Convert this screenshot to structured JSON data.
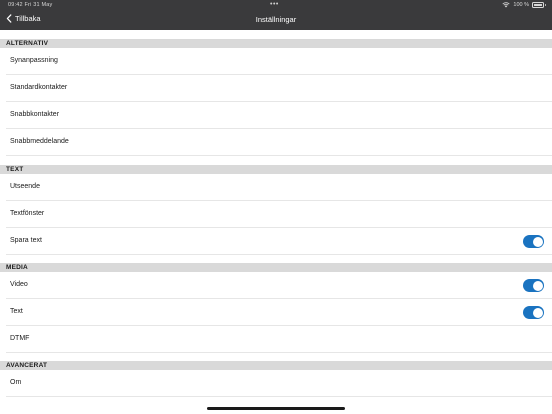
{
  "status": {
    "time": "09:42",
    "date": "Fri 31 May",
    "dots": "•••",
    "battery": "100 %"
  },
  "nav": {
    "back_label": "Tillbaka",
    "title": "Inställningar"
  },
  "sections": {
    "alternativ": {
      "header": "ALTERNATIV",
      "items": [
        "Synanpassning",
        "Standardkontakter",
        "Snabbkontakter",
        "Snabbmeddelande"
      ]
    },
    "text": {
      "header": "TEXT",
      "items": [
        "Utseende",
        "Textfönster",
        "Spara text"
      ],
      "spara_text_on": true
    },
    "media": {
      "header": "MEDIA",
      "items": [
        "Video",
        "Text",
        "DTMF"
      ],
      "video_on": true,
      "text_on": true
    },
    "avancerat": {
      "header": "AVANCERAT",
      "items": [
        "Om"
      ]
    }
  },
  "colors": {
    "topbar": "#3a3a3c",
    "section_header_bg": "#d9d9d9",
    "toggle_on": "#1a73c0"
  }
}
